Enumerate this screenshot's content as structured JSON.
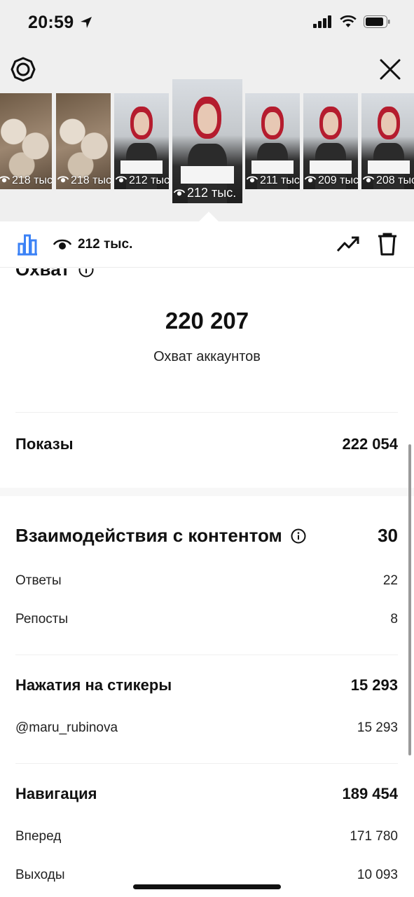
{
  "status": {
    "time": "20:59"
  },
  "thumbnails": [
    {
      "views": "218 тыс.",
      "kind": "food"
    },
    {
      "views": "218 тыс.",
      "kind": "food"
    },
    {
      "views": "212 тыс.",
      "kind": "woman"
    },
    {
      "views": "212 тыс.",
      "kind": "woman",
      "selected": true
    },
    {
      "views": "211 тыс.",
      "kind": "woman"
    },
    {
      "views": "209 тыс.",
      "kind": "woman"
    },
    {
      "views": "208 тыс.",
      "kind": "woman"
    }
  ],
  "toolbar": {
    "views": "212 тыс."
  },
  "reach": {
    "title": "Охват",
    "number": "220 207",
    "label": "Охват аккаунтов"
  },
  "impressions": {
    "label": "Показы",
    "value": "222 054"
  },
  "engagement": {
    "title": "Взаимодействия с контентом",
    "value": "30",
    "replies": {
      "label": "Ответы",
      "value": "22"
    },
    "shares": {
      "label": "Репосты",
      "value": "8"
    }
  },
  "stickers": {
    "title": "Нажатия на стикеры",
    "value": "15 293",
    "items": [
      {
        "label": "@maru_rubinova",
        "value": "15 293"
      }
    ]
  },
  "navigation": {
    "title": "Навигация",
    "value": "189 454",
    "forward": {
      "label": "Вперед",
      "value": "171 780"
    },
    "exits": {
      "label": "Выходы",
      "value": "10 093"
    }
  },
  "colors": {
    "accent": "#3b82f6",
    "text": "#111111",
    "header_bg": "#efefef"
  }
}
